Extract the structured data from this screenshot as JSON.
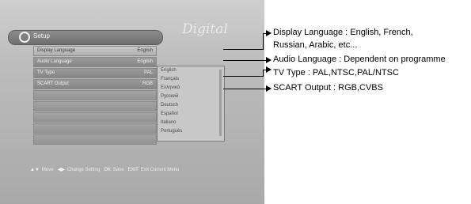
{
  "screen": {
    "brand": "Digital",
    "title": "Setup",
    "menu": [
      {
        "label": "Display Language",
        "value": "English"
      },
      {
        "label": "Audio Language",
        "value": "English"
      },
      {
        "label": "TV Type",
        "value": "PAL"
      },
      {
        "label": "SCART Output",
        "value": "RGB"
      }
    ],
    "dropdown": [
      "English",
      "Français",
      "Ελληνικά",
      "Русский",
      "Deutsch",
      "Español",
      "Italiano",
      "Português"
    ],
    "legend": [
      {
        "key": "▲▼",
        "text": "Move"
      },
      {
        "key": "◀▶",
        "text": "Change Setting"
      },
      {
        "key": "OK",
        "text": "Save"
      },
      {
        "key": "EXIT",
        "text": "Exit Current Menu"
      }
    ]
  },
  "annotations": {
    "display_language_line1": "Display Language : English, French,",
    "display_language_line2": "Russian, Arabic, etc...",
    "audio_language": "Audio Language : Dependent on programme",
    "tv_type": "TV Type : PAL,NTSC,PAL/NTSC",
    "scart_output": "SCART Output : RGB,CVBS"
  }
}
